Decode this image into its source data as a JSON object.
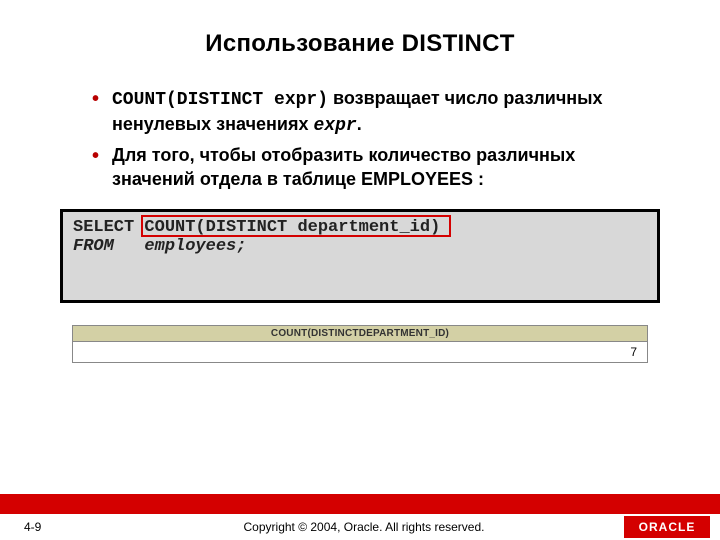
{
  "title": "Использование DISTINCT",
  "bullets": [
    {
      "pre": "COUNT(DISTINCT expr)",
      "mid": " возвращает число различных ненулевых значениях ",
      "post": "expr",
      "tail": "."
    },
    {
      "text": "Для того, чтобы отобразить количество различных значений отдела в таблице EMPLOYEES :"
    }
  ],
  "code": {
    "line1a": "SELECT ",
    "line1b": "COUNT(DISTINCT department_id)",
    "line2": "FROM   employees;"
  },
  "result": {
    "header": "COUNT(DISTINCTDEPARTMENT_ID)",
    "value": "7"
  },
  "footer": {
    "page": "4-9",
    "copyright": "Copyright © 2004, Oracle.  All rights reserved.",
    "logo": "ORACLE"
  },
  "chart_data": {
    "type": "table",
    "columns": [
      "COUNT(DISTINCTDEPARTMENT_ID)"
    ],
    "rows": [
      [
        7
      ]
    ]
  }
}
